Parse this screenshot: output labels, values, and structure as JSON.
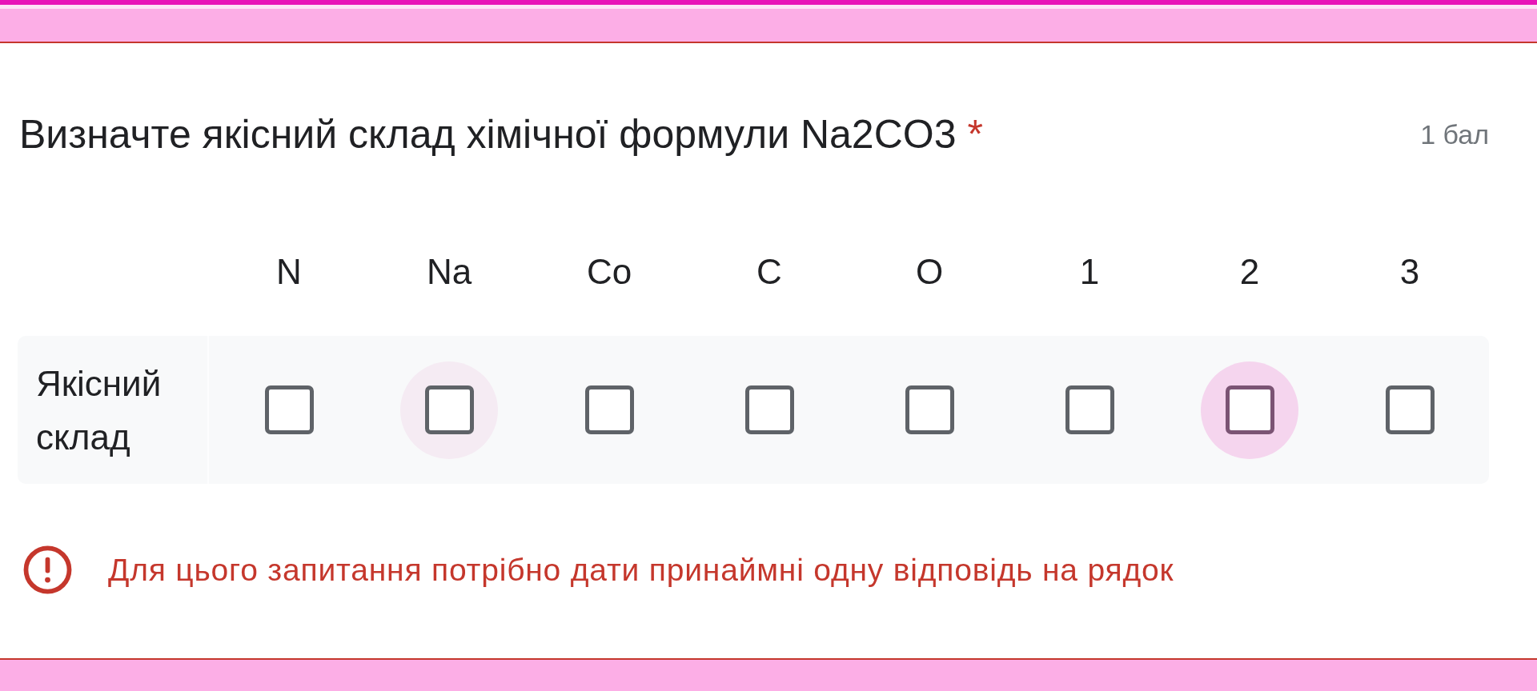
{
  "question": {
    "title": "Визначте якісний склад хімічної формули Na2CO3",
    "required_mark": "*",
    "points": "1 бал",
    "invalid": true
  },
  "grid": {
    "columns": [
      "N",
      "Na",
      "Co",
      "C",
      "O",
      "1",
      "2",
      "3"
    ],
    "rows": [
      {
        "label": "Якісний склад",
        "cells": [
          {
            "checked": false,
            "hovered": false,
            "focused": false
          },
          {
            "checked": false,
            "hovered": true,
            "focused": false
          },
          {
            "checked": false,
            "hovered": false,
            "focused": false
          },
          {
            "checked": false,
            "hovered": false,
            "focused": false
          },
          {
            "checked": false,
            "hovered": false,
            "focused": false
          },
          {
            "checked": false,
            "hovered": false,
            "focused": false
          },
          {
            "checked": false,
            "hovered": false,
            "focused": true
          },
          {
            "checked": false,
            "hovered": false,
            "focused": false
          }
        ]
      }
    ]
  },
  "error": {
    "message": "Для цього запитання потрібно дати принаймні одну відповідь на рядок"
  }
}
